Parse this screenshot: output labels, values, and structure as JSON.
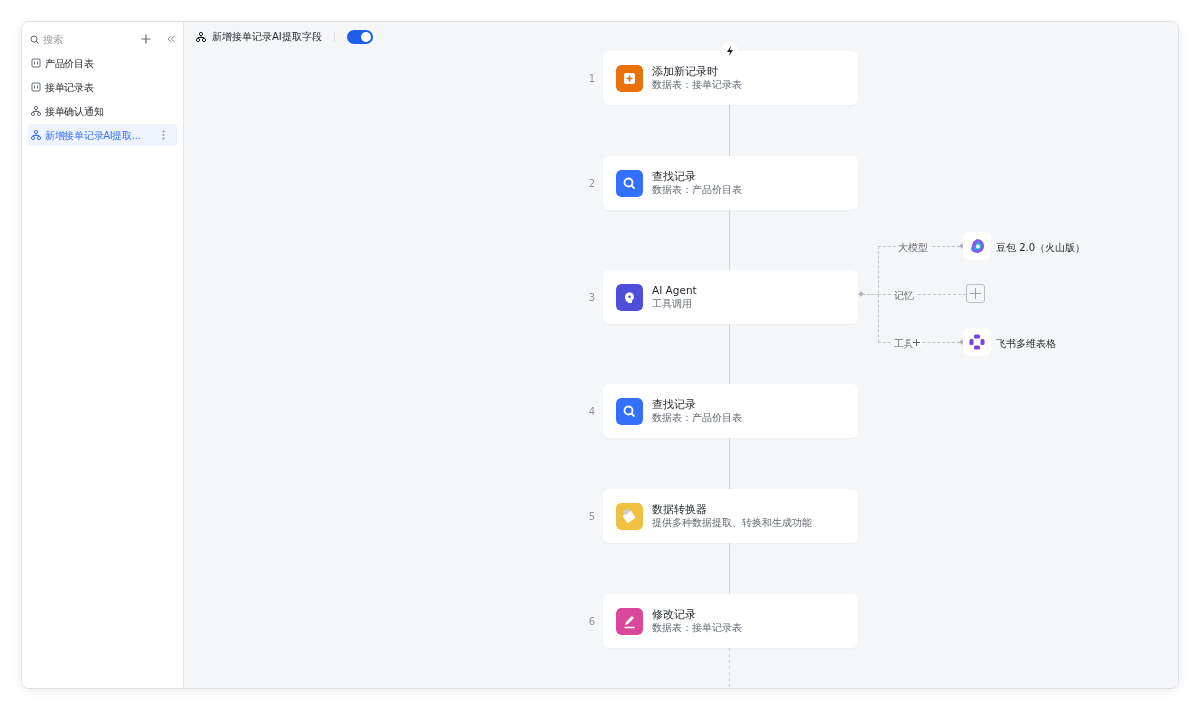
{
  "sidebar": {
    "search": {
      "placeholder": "搜索"
    },
    "items": [
      {
        "label": "产品价目表",
        "kind": "table",
        "selected": false
      },
      {
        "label": "接单记录表",
        "kind": "table",
        "selected": false
      },
      {
        "label": "接单确认通知",
        "kind": "workflow",
        "selected": false
      },
      {
        "label": "新增接单记录AI提取...",
        "kind": "workflow",
        "selected": true
      }
    ]
  },
  "header": {
    "title": "新增接单记录AI提取字段",
    "enabled": true
  },
  "steps": [
    {
      "number": "1",
      "title": "添加新记录时",
      "subtitle": "数据表：接单记录表",
      "kind": "trigger"
    },
    {
      "number": "2",
      "title": "查找记录",
      "subtitle": "数据表：产品价目表",
      "kind": "find"
    },
    {
      "number": "3",
      "title": "AI Agent",
      "subtitle": "工具调用",
      "kind": "agent",
      "branches": [
        {
          "label": "大模型",
          "kind": "model",
          "target": "豆包 2.0（火山版）"
        },
        {
          "label": "记忆",
          "kind": "empty"
        },
        {
          "label": "工具",
          "kind": "tool",
          "target": "飞书多维表格"
        }
      ]
    },
    {
      "number": "4",
      "title": "查找记录",
      "subtitle": "数据表：产品价目表",
      "kind": "find"
    },
    {
      "number": "5",
      "title": "数据转换器",
      "subtitle": "提供多种数据提取、转换和生成功能",
      "kind": "converter"
    },
    {
      "number": "6",
      "title": "修改记录",
      "subtitle": "数据表：接单记录表",
      "kind": "edit"
    }
  ]
}
